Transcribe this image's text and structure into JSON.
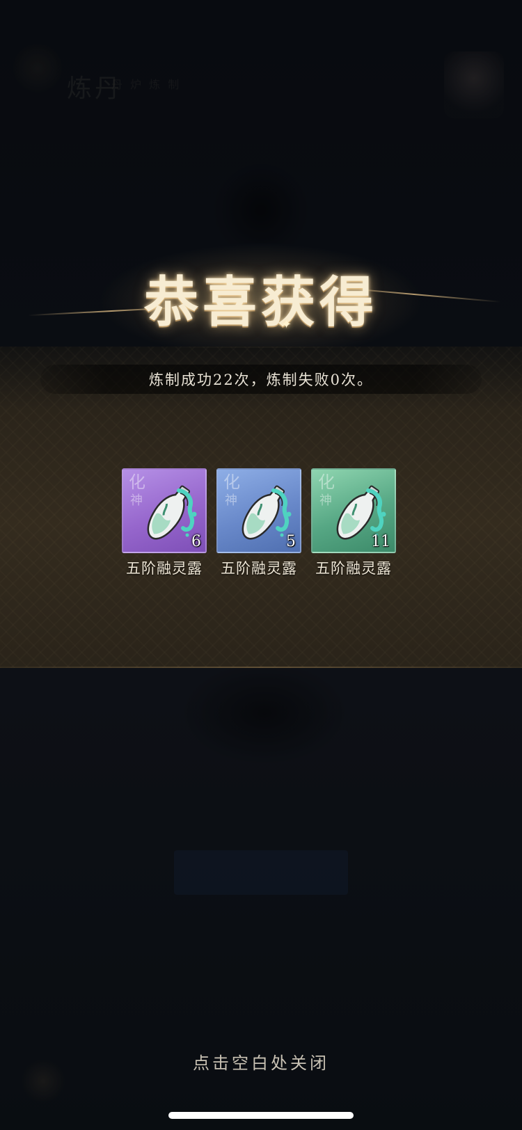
{
  "background": {
    "header_title": "炼丹",
    "header_subtitle": "丹 炉 炼 制",
    "lower_text": "",
    "lower_button": ""
  },
  "title": "恭喜获得",
  "result_text": "炼制成功22次，炼制失败0次。",
  "items": [
    {
      "name": "五阶融灵露",
      "count": "6",
      "grade_1": "化",
      "grade_2": "神",
      "rarity_color": "#9666cc",
      "icon": "spirit-dew-bottle-icon"
    },
    {
      "name": "五阶融灵露",
      "count": "5",
      "grade_1": "化",
      "grade_2": "神",
      "rarity_color": "#6888c9",
      "icon": "spirit-dew-bottle-icon"
    },
    {
      "name": "五阶融灵露",
      "count": "11",
      "grade_1": "化",
      "grade_2": "神",
      "rarity_color": "#56a784",
      "icon": "spirit-dew-bottle-icon"
    }
  ],
  "close_hint": "点击空白处关闭"
}
